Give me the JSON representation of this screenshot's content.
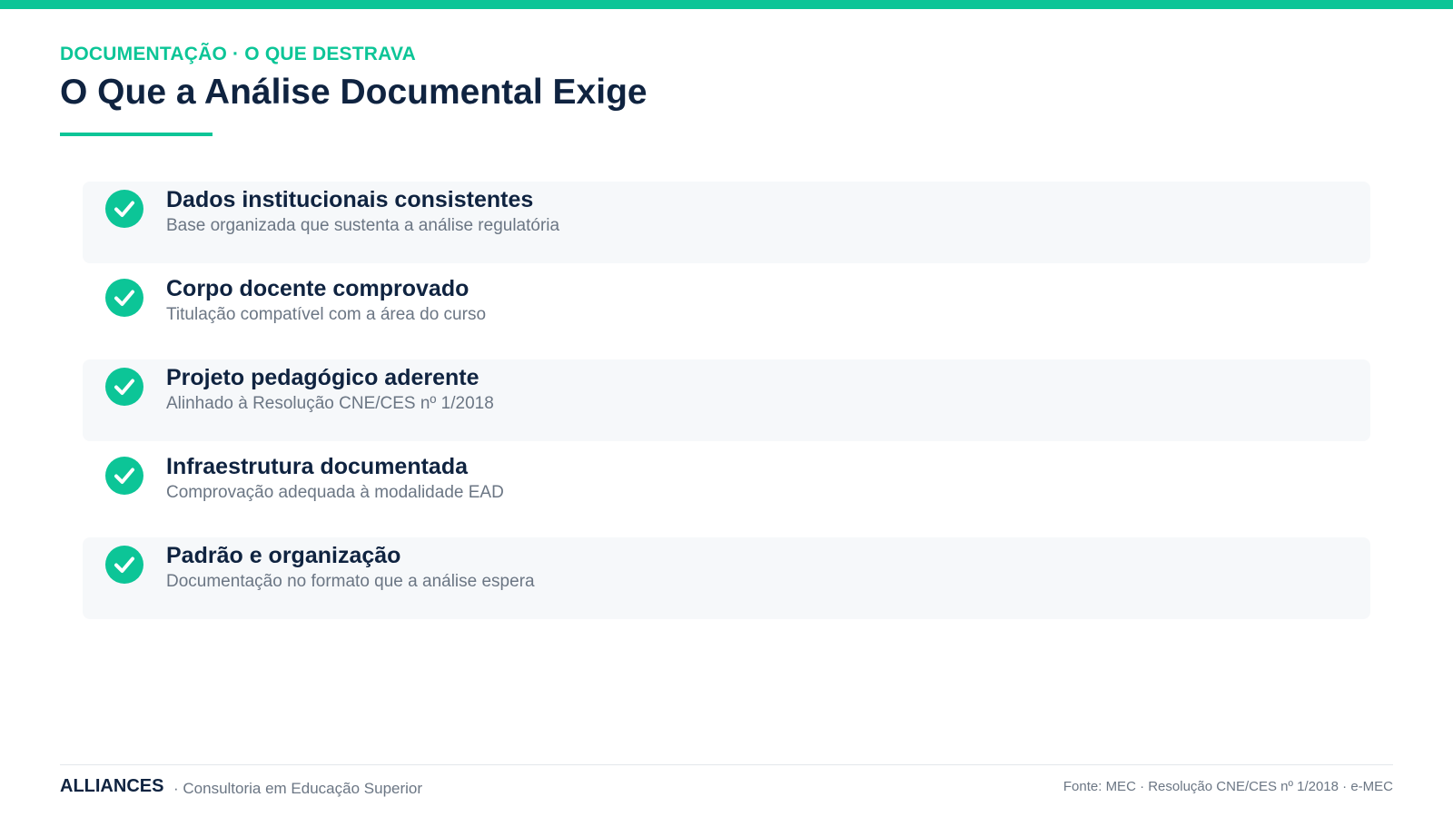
{
  "header": {
    "kicker": "DOCUMENTAÇÃO · O QUE DESTRAVA",
    "title": "O Que a Análise Documental Exige"
  },
  "items": [
    {
      "title": "Dados institucionais consistentes",
      "description": "Base organizada que sustenta a análise regulatória"
    },
    {
      "title": "Corpo docente comprovado",
      "description": "Titulação compatível com a área do curso"
    },
    {
      "title": "Projeto pedagógico aderente",
      "description": "Alinhado à Resolução CNE/CES nº 1/2018"
    },
    {
      "title": "Infraestrutura documentada",
      "description": "Comprovação adequada à modalidade EAD"
    },
    {
      "title": "Padrão e organização",
      "description": "Documentação no formato que a análise espera"
    }
  ],
  "footer": {
    "brand": "ALLIANCES",
    "tagline": "· Consultoria em Educação Superior",
    "source": "Fonte: MEC · Resolução CNE/CES nº 1/2018 · e-MEC"
  },
  "icons": {
    "item_check": "check-circle-icon"
  },
  "colors": {
    "accent": "#0cc597",
    "heading": "#0f2340",
    "muted": "#6b7684",
    "row_shade": "#f6f8fa"
  }
}
